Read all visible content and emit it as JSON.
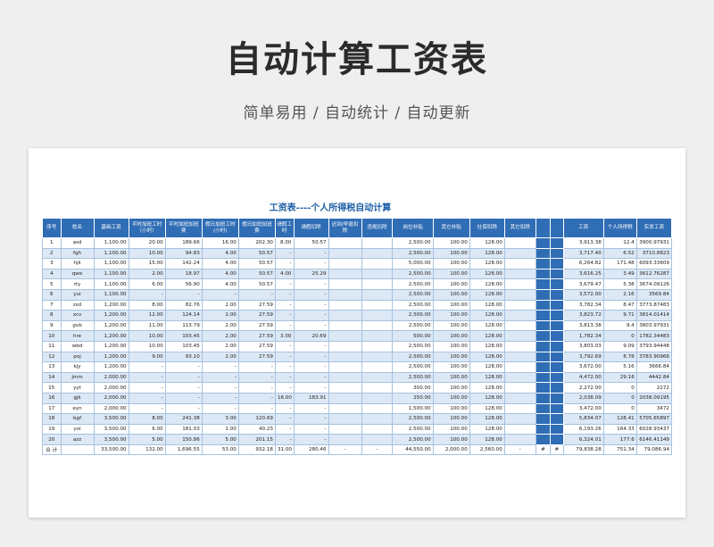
{
  "hero": {
    "title": "自动计算工资表",
    "subtitle": "简单易用 / 自动统计 / 自动更新"
  },
  "table_title": "工资表----个人所得税自动计算",
  "headers": [
    "序号",
    "姓名",
    "基础工资",
    "平时加班工时（小时）",
    "平时加班加班费",
    "假日加班工时(小时)",
    "假日加班加班费",
    "请假工时",
    "请假扣除",
    "迟到/早退扣除",
    "违规扣除",
    "岗位补贴",
    "其它补贴",
    "社保扣除",
    "其它扣除",
    "",
    "",
    "工资",
    "个人所得税",
    "实发工资"
  ],
  "rows": [
    [
      "1",
      "asd",
      "1,100.00",
      "20.00",
      "189.66",
      "16.00",
      "202.30",
      "8.00",
      "50.57",
      "",
      "",
      "2,500.00",
      "100.00",
      "128.00",
      "",
      "",
      "",
      "3,913.38",
      "12.4",
      "3900.97931"
    ],
    [
      "2",
      "fgh",
      "1,100.00",
      "10.00",
      "94.83",
      "4.00",
      "50.57",
      "-",
      "-",
      "",
      "",
      "2,500.00",
      "100.00",
      "128.00",
      "",
      "",
      "",
      "3,717.40",
      "6.52",
      "3710.8823"
    ],
    [
      "3",
      "hjk",
      "1,100.00",
      "15.00",
      "142.24",
      "4.00",
      "50.57",
      "-",
      "-",
      "",
      "",
      "5,000.00",
      "100.00",
      "128.00",
      "",
      "",
      "",
      "6,264.82",
      "171.48",
      "6093.33609"
    ],
    [
      "4",
      "qwe",
      "1,100.00",
      "2.00",
      "18.97",
      "4.00",
      "50.57",
      "4.00",
      "25.29",
      "",
      "",
      "2,500.00",
      "100.00",
      "128.00",
      "",
      "",
      "",
      "3,616.25",
      "3.49",
      "3612.76287"
    ],
    [
      "5",
      "rty",
      "1,100.00",
      "6.00",
      "56.90",
      "4.00",
      "50.57",
      "-",
      "-",
      "",
      "",
      "2,500.00",
      "100.00",
      "128.00",
      "",
      "",
      "",
      "3,679.47",
      "5.38",
      "3674.09126"
    ],
    [
      "6",
      "yui",
      "1,100.00",
      "-",
      "-",
      "-",
      "-",
      "-",
      "-",
      "",
      "",
      "2,500.00",
      "100.00",
      "128.00",
      "",
      "",
      "",
      "3,572.00",
      "2.16",
      "3569.84"
    ],
    [
      "7",
      "zsd",
      "1,200.00",
      "8.00",
      "82.76",
      "2.00",
      "27.59",
      "-",
      "-",
      "",
      "",
      "2,500.00",
      "100.00",
      "128.00",
      "",
      "",
      "",
      "3,782.34",
      "8.47",
      "3773.87483"
    ],
    [
      "8",
      "xcv",
      "1,200.00",
      "12.00",
      "124.14",
      "2.00",
      "27.59",
      "-",
      "-",
      "",
      "",
      "2,500.00",
      "100.00",
      "128.00",
      "",
      "",
      "",
      "3,823.72",
      "9.71",
      "3814.01414"
    ],
    [
      "9",
      "gvb",
      "1,200.00",
      "11.00",
      "113.79",
      "2.00",
      "27.59",
      "-",
      "-",
      "",
      "",
      "2,500.00",
      "100.00",
      "128.00",
      "",
      "",
      "",
      "3,813.38",
      "9.4",
      "3803.97931"
    ],
    [
      "10",
      "hre",
      "1,200.00",
      "10.00",
      "103.45",
      "2.00",
      "27.59",
      "3.00",
      "20.69",
      "",
      "",
      "500.00",
      "100.00",
      "128.00",
      "",
      "",
      "",
      "1,782.34",
      "0",
      "1782.34483"
    ],
    [
      "11",
      "wbd",
      "1,200.00",
      "10.00",
      "103.45",
      "2.00",
      "27.59",
      "-",
      "-",
      "",
      "",
      "2,500.00",
      "100.00",
      "128.00",
      "",
      "",
      "",
      "3,803.03",
      "9.09",
      "3793.94448"
    ],
    [
      "12",
      "poj",
      "1,200.00",
      "9.00",
      "93.10",
      "2.00",
      "27.59",
      "-",
      "-",
      "",
      "",
      "2,500.00",
      "100.00",
      "128.00",
      "",
      "",
      "",
      "3,792.69",
      "8.78",
      "3783.90966"
    ],
    [
      "13",
      "kjy",
      "1,200.00",
      "-",
      "-",
      "-",
      "-",
      "-",
      "-",
      "",
      "",
      "2,500.00",
      "100.00",
      "128.00",
      "",
      "",
      "",
      "3,672.00",
      "5.16",
      "3666.84"
    ],
    [
      "14",
      "jmm",
      "2,000.00",
      "-",
      "-",
      "-",
      "-",
      "-",
      "-",
      "",
      "",
      "2,500.00",
      "100.00",
      "128.00",
      "",
      "",
      "",
      "4,472.00",
      "29.16",
      "4442.84"
    ],
    [
      "15",
      "yyt",
      "2,000.00",
      "-",
      "-",
      "-",
      "-",
      "-",
      "-",
      "",
      "",
      "300.00",
      "100.00",
      "128.00",
      "",
      "",
      "",
      "2,272.00",
      "0",
      "2272"
    ],
    [
      "16",
      "gjk",
      "2,000.00",
      "-",
      "-",
      "-",
      "-",
      "16.00",
      "183.91",
      "",
      "",
      "250.00",
      "100.00",
      "128.00",
      "",
      "",
      "",
      "2,038.09",
      "0",
      "2038.09195"
    ],
    [
      "17",
      "eyn",
      "2,000.00",
      "-",
      "-",
      "-",
      "-",
      "-",
      "-",
      "",
      "",
      "1,500.00",
      "100.00",
      "128.00",
      "",
      "",
      "",
      "3,472.00",
      "0",
      "3472"
    ],
    [
      "18",
      "bgf",
      "3,500.00",
      "8.00",
      "241.38",
      "3.00",
      "120.69",
      "-",
      "-",
      "",
      "",
      "2,500.00",
      "100.00",
      "128.00",
      "",
      "",
      "",
      "5,834.07",
      "128.41",
      "5705.65897"
    ],
    [
      "19",
      "yoi",
      "3,500.00",
      "6.00",
      "181.03",
      "1.00",
      "40.23",
      "-",
      "-",
      "",
      "",
      "2,500.00",
      "100.00",
      "128.00",
      "",
      "",
      "",
      "6,193.26",
      "164.33",
      "6028.93437"
    ],
    [
      "20",
      "azz",
      "3,500.00",
      "5.00",
      "150.86",
      "5.00",
      "201.15",
      "-",
      "-",
      "",
      "",
      "2,500.00",
      "100.00",
      "128.00",
      "",
      "",
      "",
      "6,324.01",
      "177.6",
      "6146.41149"
    ]
  ],
  "total": [
    "合  计",
    "",
    "33,500.00",
    "132.00",
    "1,696.55",
    "53.00",
    "932.18",
    "31.00",
    "280.46",
    "-",
    "-",
    "44,550.00",
    "2,000.00",
    "2,560.00",
    "-",
    "#",
    "#",
    "79,838.28",
    "751.34",
    "79,086.94"
  ],
  "colors": {
    "header_bg": "#2f6db5",
    "stripe": "#dce8f5",
    "title": "#1f5fa8"
  }
}
